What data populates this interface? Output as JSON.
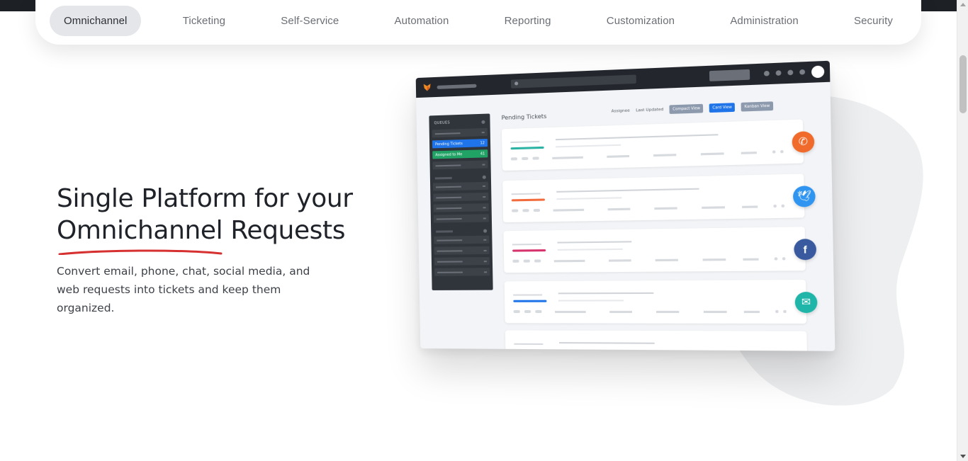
{
  "nav": {
    "tabs": [
      {
        "label": "Omnichannel",
        "active": true
      },
      {
        "label": "Ticketing",
        "active": false
      },
      {
        "label": "Self-Service",
        "active": false
      },
      {
        "label": "Automation",
        "active": false
      },
      {
        "label": "Reporting",
        "active": false
      },
      {
        "label": "Customization",
        "active": false
      },
      {
        "label": "Administration",
        "active": false
      },
      {
        "label": "Security",
        "active": false
      }
    ]
  },
  "hero": {
    "title_line1": "Single Platform for your",
    "title_highlight": "Omnichannel",
    "title_rest": " Requests",
    "description": "Convert email, phone, chat, social media, and web requests into tickets and keep them organized."
  },
  "mockup": {
    "sidebar_header": "QUEUES",
    "queue_pending": "Pending Tickets",
    "queue_pending_count": "12",
    "queue_assigned": "Assigned to Me",
    "queue_assigned_count": "41",
    "main_title": "Pending Tickets",
    "filter_assignee": "Assignee",
    "filter_updated": "Last Updated",
    "view_compact": "Compact View",
    "view_card": "Card View",
    "view_kanban": "Kanban View",
    "channels": [
      {
        "icon": "phone-icon",
        "glyph": "✆",
        "color": "#f06a2b",
        "accent": "#2bb3a3"
      },
      {
        "icon": "twitter-icon",
        "glyph": "🕊",
        "color": "#2f95f0",
        "accent": "#f26b3c"
      },
      {
        "icon": "facebook-icon",
        "glyph": "f",
        "color": "#3a5aa0",
        "accent": "#d6336c"
      },
      {
        "icon": "email-icon",
        "glyph": "✉",
        "color": "#1fb5a8",
        "accent": "#1e74e8"
      },
      {
        "icon": "chat-icon",
        "glyph": "",
        "color": "#cc33cc",
        "accent": "#cc33cc"
      }
    ]
  },
  "colors": {
    "accent_underline": "#d63030",
    "active_tab_bg": "#e4e6e9",
    "blob": "#eeeff1"
  }
}
